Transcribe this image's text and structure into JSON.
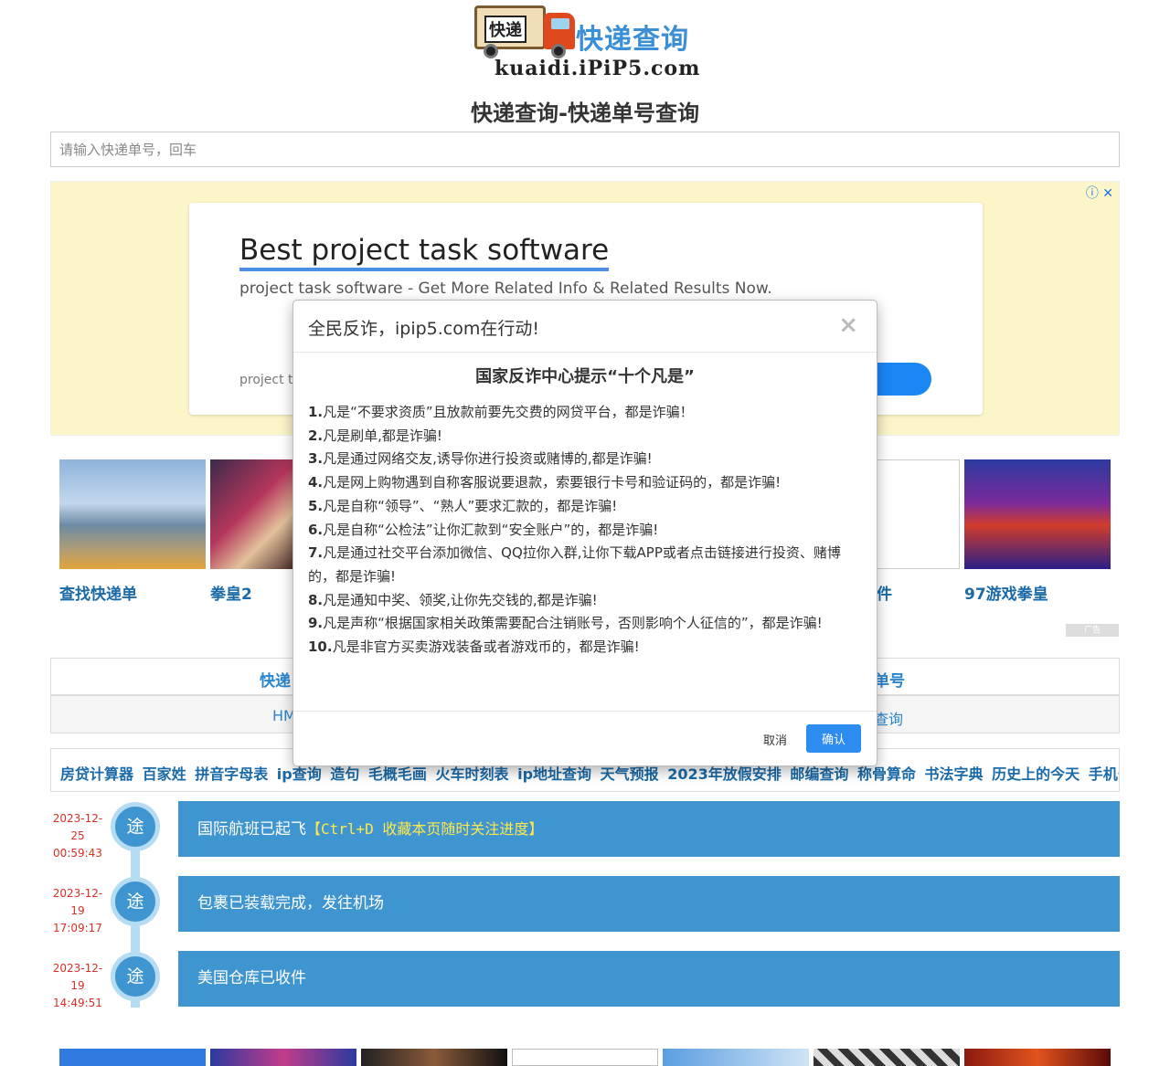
{
  "logo": {
    "badge": "快递",
    "brand": "快递查询",
    "domain": "kuaidi.iPiP5.com"
  },
  "page_title": "快递查询-快递单号查询",
  "search": {
    "placeholder": "请输入快递单号，回车",
    "value": ""
  },
  "ad": {
    "controls": "ⓘ ✕",
    "headline": "Best project task software",
    "description": "project task software - Get More Related Info & Related Results Now.",
    "footer_text": "project ta"
  },
  "thumbs": [
    {
      "caption": "查找快递单"
    },
    {
      "caption": "拳皇2"
    },
    {
      "caption": "件"
    },
    {
      "caption": "97游戏拳皇"
    }
  ],
  "ad_badge": "广告",
  "nav": {
    "row1": [
      "快递",
      "单号"
    ],
    "row2": [
      "HM",
      "查询"
    ]
  },
  "links": [
    "房贷计算器",
    "百家姓",
    "拼音字母表",
    "ip查询",
    "造句",
    "毛概毛画",
    "火车时刻表",
    "ip地址查询",
    "天气预报",
    "2023年放假安排",
    "邮编查询",
    "称骨算命",
    "书法字典",
    "历史上的今天",
    "手机号码吉凶"
  ],
  "timeline": [
    {
      "date": "2023-12-25",
      "time": "00:59:43",
      "icon": "途",
      "text": "国际航班已起飞",
      "highlight": "【Ctrl+D 收藏本页随时关注进度】"
    },
    {
      "date": "2023-12-19",
      "time": "17:09:17",
      "icon": "途",
      "text": "包裹已装载完成，发往机场",
      "highlight": ""
    },
    {
      "date": "2023-12-19",
      "time": "14:49:51",
      "icon": "途",
      "text": "美国仓库已收件",
      "highlight": ""
    }
  ],
  "modal": {
    "title": "全民反诈，ipip5.com在行动!",
    "close": "×",
    "heading": "国家反诈中心提示“十个凡是”",
    "items": [
      {
        "num": "1.",
        "text": "凡是“不要求资质”且放款前要先交费的网贷平台，都是诈骗！"
      },
      {
        "num": "2.",
        "text": "凡是刷单,都是诈骗!"
      },
      {
        "num": "3.",
        "text": "凡是通过网络交友,诱导你进行投资或赌博的,都是诈骗!"
      },
      {
        "num": "4.",
        "text": "凡是网上购物遇到自称客服说要退款，索要银行卡号和验证码的，都是诈骗!"
      },
      {
        "num": "5.",
        "text": "凡是自称“领导”、“熟人”要求汇款的，都是诈骗!"
      },
      {
        "num": "6.",
        "text": "凡是自称“公检法”让你汇款到“安全账户”的，都是诈骗!"
      },
      {
        "num": "7.",
        "text": "凡是通过社交平台添加微信、QQ拉你入群,让你下载APP或者点击链接进行投资、赌博的，都是诈骗!"
      },
      {
        "num": "8.",
        "text": "凡是通知中奖、领奖,让你先交钱的,都是诈骗!"
      },
      {
        "num": "9.",
        "text": "凡是声称“根据国家相关政策需要配合注销账号，否则影响个人征信的”，都是诈骗!"
      },
      {
        "num": "10.",
        "text": "凡是非官方买卖游戏装备或者游戏币的，都是诈骗!"
      }
    ],
    "cancel": "取消",
    "ok": "确认"
  }
}
